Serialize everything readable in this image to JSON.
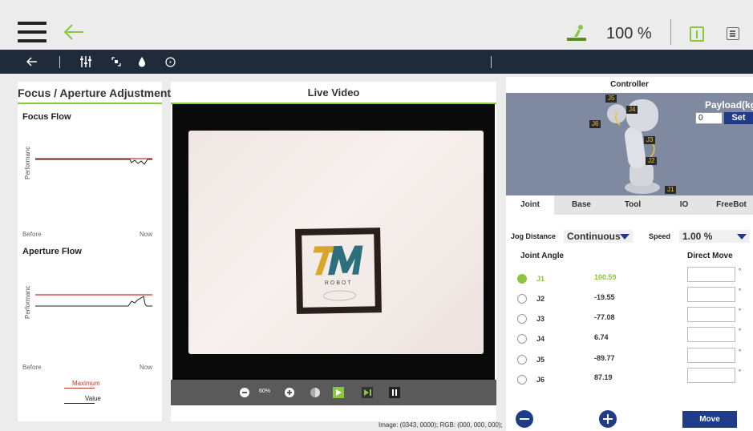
{
  "topbar": {
    "speed": "100 %"
  },
  "left_panel": {
    "title": "Focus / Aperture Adjustment",
    "focus_title": "Focus Flow",
    "aperture_title": "Aperture Flow",
    "y_label": "Performanc",
    "x_before": "Before",
    "x_now": "Now",
    "legend_maximum": "Maximum",
    "legend_value": "Value",
    "maximum_color": "#c0392b",
    "value_color": "#222222"
  },
  "video": {
    "title": "Live Video",
    "zoom": "60%",
    "logo_text": "ROBOT",
    "status": "Image: (0343, 0000); RGB: (000, 000, 000);"
  },
  "controller": {
    "title": "Controller",
    "payload_label": "Payload(kg)",
    "payload_value": "0",
    "set_label": "Set",
    "joint_labels": [
      "J1",
      "J2",
      "J3",
      "J4",
      "J5",
      "J6"
    ],
    "tabs": [
      "Joint",
      "Base",
      "Tool",
      "IO",
      "FreeBot"
    ],
    "active_tab": "Joint",
    "jog_distance_label": "Jog Distance",
    "jog_distance_value": "Continuous",
    "speed_label": "Speed",
    "speed_value": "1.00 %",
    "joint_angle_label": "Joint Angle",
    "direct_move_label": "Direct Move",
    "degree_symbol": "°",
    "joints": [
      {
        "name": "J1",
        "value": "100.59",
        "selected": true
      },
      {
        "name": "J2",
        "value": "-19.55",
        "selected": false
      },
      {
        "name": "J3",
        "value": "-77.08",
        "selected": false
      },
      {
        "name": "J4",
        "value": "6.74",
        "selected": false
      },
      {
        "name": "J5",
        "value": "-89.77",
        "selected": false
      },
      {
        "name": "J6",
        "value": "87.19",
        "selected": false
      }
    ],
    "move_label": "Move"
  },
  "colors": {
    "accent": "#8cc63f",
    "navy": "#1f2b3a",
    "button_blue": "#1f3c88"
  }
}
